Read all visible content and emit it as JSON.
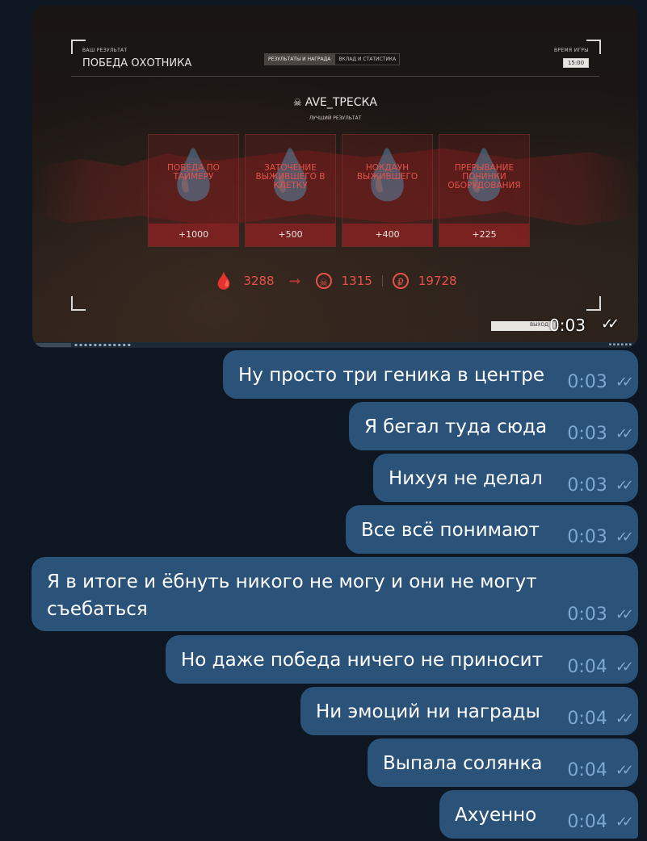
{
  "media": {
    "game": {
      "your_result_label": "ВАШ РЕЗУЛЬТАТ",
      "result_title": "ПОБЕДА ОХОТНИКА",
      "tabs": [
        {
          "label": "РЕЗУЛЬТАТЫ И НАГРАДА",
          "active": true
        },
        {
          "label": "ВКЛАД И СТАТИСТИКА",
          "active": false
        }
      ],
      "game_time_label": "ВРЕМЯ ИГРЫ",
      "game_time_value": "15:00",
      "player_name": "AVE_ТРЕСКА",
      "best_result_label": "ЛУЧШИЙ РЕЗУЛЬТАТ",
      "cards": [
        {
          "label": "ПОБЕДА ПО ТАЙМЕРУ",
          "points": "+1000"
        },
        {
          "label": "ЗАТОЧЕНИЕ ВЫЖИВШЕГО В КЛЕТКУ",
          "points": "+500"
        },
        {
          "label": "НОКДАУН ВЫЖИВШЕГО",
          "points": "+400"
        },
        {
          "label": "ПРЕРЫВАНИЕ ПОЧИНКИ ОБОРУДОВАНИЯ",
          "points": "+225"
        }
      ],
      "totals": {
        "blood_points": "3288",
        "skull_points": "1315",
        "currency": "19728"
      },
      "exit_label": "ВЫХОД"
    },
    "time": "0:03"
  },
  "messages": [
    {
      "text": "Ну просто три геника в центре",
      "time": "0:03"
    },
    {
      "text": "Я бегал туда сюда",
      "time": "0:03"
    },
    {
      "text": "Нихуя не делал",
      "time": "0:03"
    },
    {
      "text": "Все всё понимают",
      "time": "0:03"
    },
    {
      "text_line1": "Я в итоге и ёбнуть никого не могу и они не могут",
      "text_line2": "съебаться",
      "time": "0:03"
    },
    {
      "text": "Но даже победа ничего не приносит",
      "time": "0:04"
    },
    {
      "text": "Ни эмоций ни награды",
      "time": "0:04"
    },
    {
      "text": "Выпала солянка",
      "time": "0:04"
    },
    {
      "text": "Ахуенно",
      "time": "0:04"
    }
  ],
  "colors": {
    "background": "#0e1621",
    "bubble": "#2b5278",
    "meta": "#7da8d3",
    "accent_red": "#e5524a"
  },
  "icons": {
    "read_receipt": "double-check-icon",
    "skull": "skull-icon",
    "blood": "blood-drop-icon",
    "currency": "ruble-icon"
  }
}
